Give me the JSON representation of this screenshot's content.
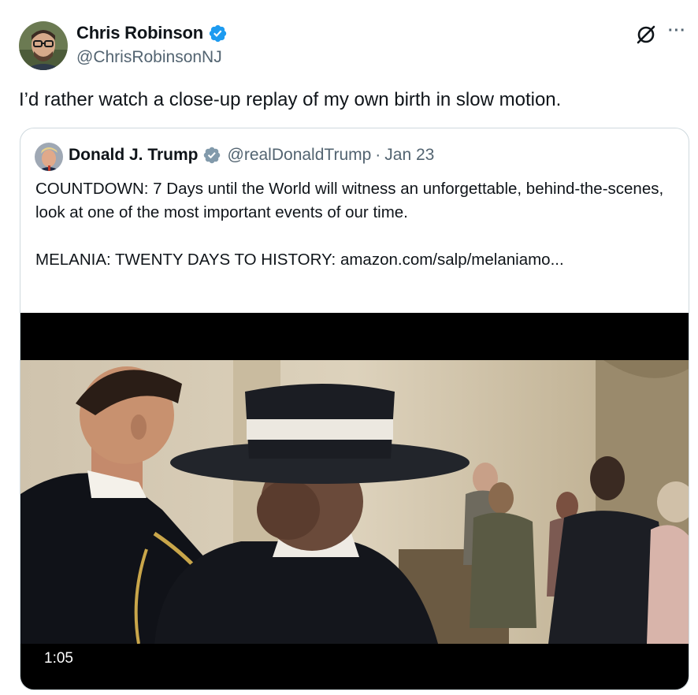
{
  "tweet": {
    "author": {
      "name": "Chris Robinson",
      "handle": "@ChrisRobinsonNJ",
      "verified": true
    },
    "text": "I’d rather watch a close-up replay of my own birth in slow motion.",
    "more_label": "···",
    "icons": {
      "grok": "grok-icon",
      "more": "more-icon",
      "verified": "verified-badge-icon"
    }
  },
  "quoted_tweet": {
    "author": {
      "name": "Donald J. Trump",
      "handle": "@realDonaldTrump",
      "separator": "·",
      "date": "Jan 23",
      "verified": true,
      "verified_style": "gray"
    },
    "paragraphs": [
      "COUNTDOWN: 7 Days until the World will witness an unforgettable, behind-the-scenes, look at one of the most important events of our time.",
      "MELANIA: TWENTY DAYS TO HISTORY: amazon.com/salp/melaniamo..."
    ],
    "video": {
      "duration": "1:05"
    }
  },
  "colors": {
    "text_primary": "#0f1419",
    "text_secondary": "#536471",
    "verified_blue": "#1d9bf0",
    "verified_gray": "#829aab",
    "border": "#cfd9de"
  }
}
